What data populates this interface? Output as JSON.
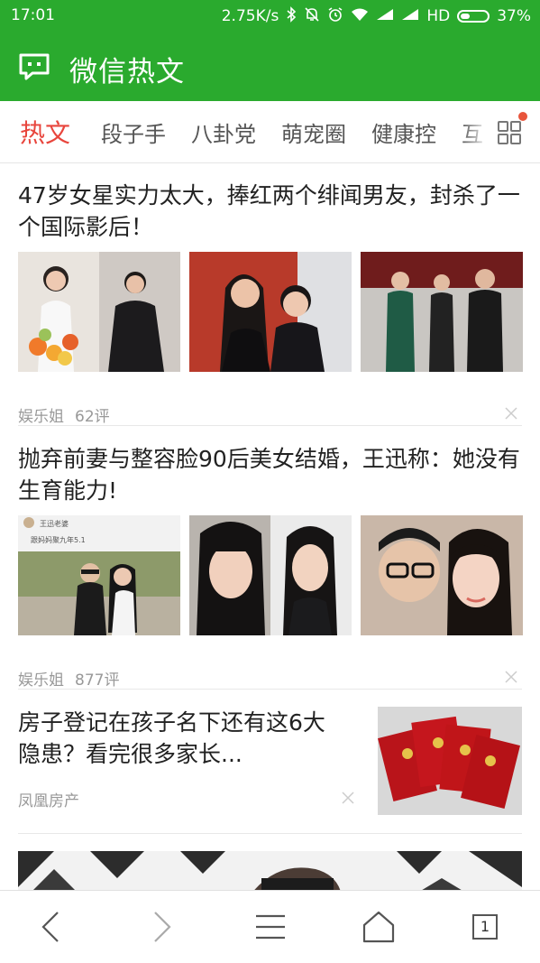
{
  "status_bar": {
    "time": "17:01",
    "speed": "2.75K/s",
    "network": "HD",
    "battery": "37%",
    "battery_level": 0.37,
    "icons": [
      "bluetooth-icon",
      "mute-icon",
      "alarm-icon",
      "wifi-icon",
      "signal-icon",
      "signal-icon",
      "battery-icon"
    ]
  },
  "app_bar": {
    "title": "微信热文",
    "icon": "chat-bubble-icon",
    "bg_color": "#2aaa2e"
  },
  "tabs": {
    "items": [
      {
        "label": "热文",
        "active": true
      },
      {
        "label": "段子手",
        "active": false
      },
      {
        "label": "八卦党",
        "active": false
      },
      {
        "label": "萌宠圈",
        "active": false
      },
      {
        "label": "健康控",
        "active": false
      },
      {
        "label": "互",
        "active": false
      }
    ],
    "active_color": "#e8453c",
    "more_icon": "grid-icon",
    "badge_color": "#e8553c"
  },
  "articles": [
    {
      "title": "47岁女星实力太大，捧红两个绯闻男友，封杀了一个国际影后！",
      "source": "娱乐姐",
      "comments": "62评",
      "layout": "three-images"
    },
    {
      "title": "抛弃前妻与整容脸90后美女结婚，王迅称：她没有生育能力!",
      "source": "娱乐姐",
      "comments": "877评",
      "layout": "three-images",
      "thumb_caption_1": "王迅老婆",
      "thumb_caption_2": "跟妈妈聚九年5.1"
    },
    {
      "title": "房子登记在孩子名下还有这6大隐患？看完很多家长...",
      "source": "凤凰房产",
      "comments": "",
      "layout": "single-image-right"
    }
  ],
  "bottom_nav": {
    "items": [
      "back-icon",
      "forward-icon",
      "menu-icon",
      "home-icon",
      "tabs-icon"
    ],
    "tab_count": "1"
  }
}
